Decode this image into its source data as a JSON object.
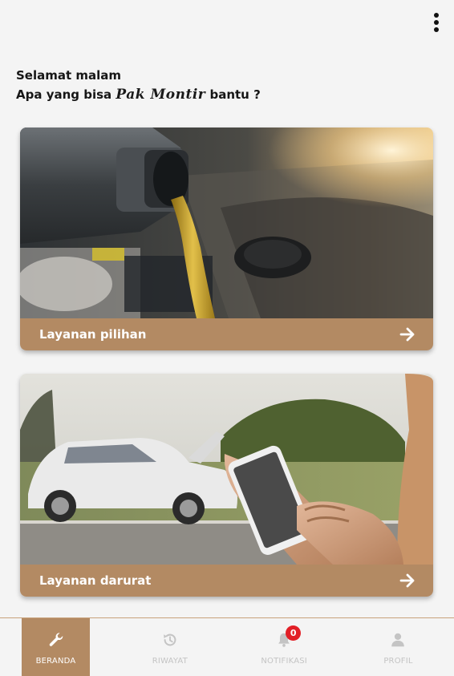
{
  "greeting": {
    "line1": "Selamat malam",
    "prefix": "Apa yang bisa",
    "brand": "Pak Montir",
    "suffix": "bantu ?"
  },
  "cards": [
    {
      "label": "Layanan pilihan",
      "image": "engine-oil-pouring-photo",
      "arrow_icon": "arrow-right-icon"
    },
    {
      "label": "Layanan darurat",
      "image": "hand-phone-broken-car-photo",
      "arrow_icon": "arrow-right-icon"
    }
  ],
  "nav": [
    {
      "label": "BERANDA",
      "icon": "wrench-icon",
      "active": true
    },
    {
      "label": "RIWAYAT",
      "icon": "history-icon",
      "active": false
    },
    {
      "label": "NOTIFIKASI",
      "icon": "bell-icon",
      "active": false,
      "badge": "0"
    },
    {
      "label": "PROFIL",
      "icon": "person-icon",
      "active": false
    }
  ],
  "colors": {
    "accent": "#b38a63",
    "background": "#f4f4f4",
    "badge": "#e21f26",
    "nav_inactive": "#c4c4c4"
  }
}
